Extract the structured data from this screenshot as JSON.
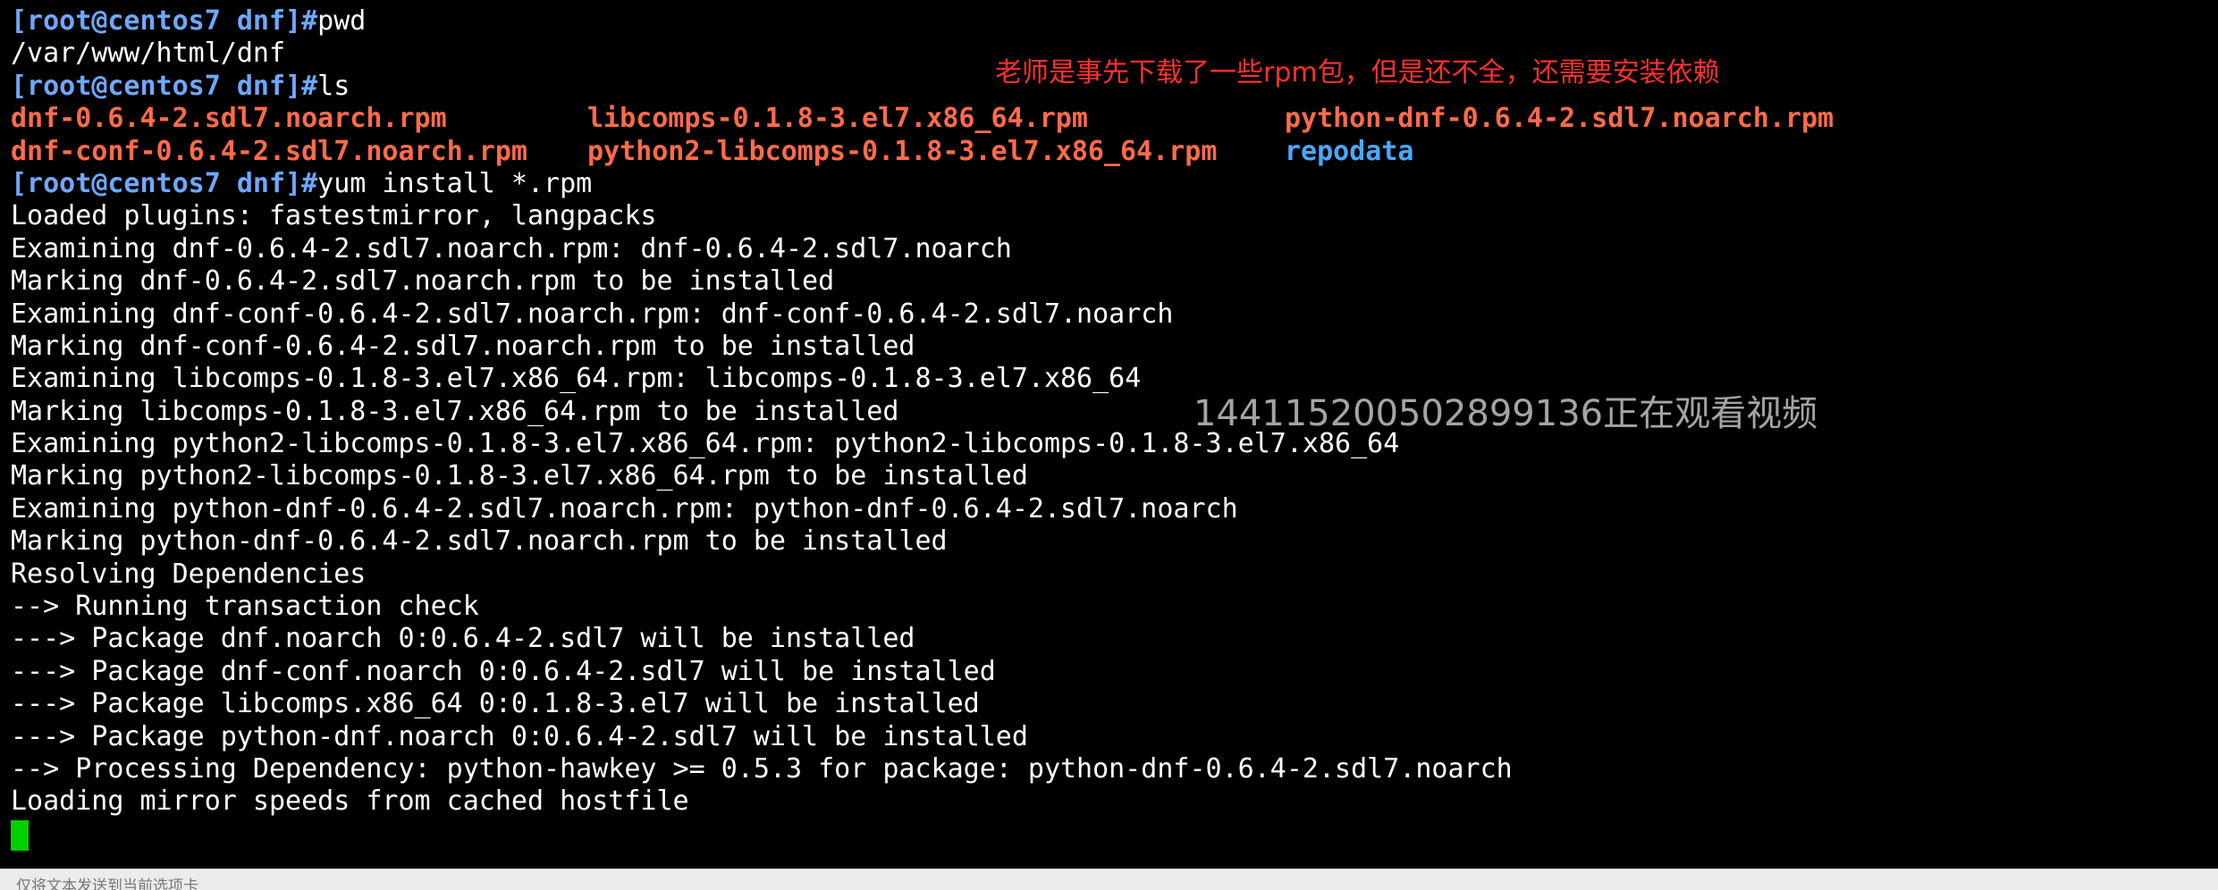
{
  "terminal": {
    "lines": [
      {
        "type": "prompt",
        "prompt": "[root@centos7 dnf]#",
        "cmd": "pwd"
      },
      {
        "type": "out",
        "text": "/var/www/html/dnf"
      },
      {
        "type": "prompt",
        "prompt": "[root@centos7 dnf]#",
        "cmd": "ls"
      },
      {
        "type": "ls",
        "items": [
          {
            "text": "dnf-0.6.4-2.sdl7.noarch.rpm",
            "kind": "rpm"
          },
          {
            "text": "libcomps-0.1.8-3.el7.x86_64.rpm",
            "kind": "rpm"
          },
          {
            "text": "python-dnf-0.6.4-2.sdl7.noarch.rpm",
            "kind": "rpm"
          }
        ]
      },
      {
        "type": "ls",
        "items": [
          {
            "text": "dnf-conf-0.6.4-2.sdl7.noarch.rpm",
            "kind": "rpm"
          },
          {
            "text": "python2-libcomps-0.1.8-3.el7.x86_64.rpm",
            "kind": "rpm"
          },
          {
            "text": "repodata",
            "kind": "dir"
          }
        ]
      },
      {
        "type": "prompt",
        "prompt": "[root@centos7 dnf]#",
        "cmd": "yum install *.rpm"
      },
      {
        "type": "out",
        "text": "Loaded plugins: fastestmirror, langpacks"
      },
      {
        "type": "out",
        "text": "Examining dnf-0.6.4-2.sdl7.noarch.rpm: dnf-0.6.4-2.sdl7.noarch"
      },
      {
        "type": "out",
        "text": "Marking dnf-0.6.4-2.sdl7.noarch.rpm to be installed"
      },
      {
        "type": "out",
        "text": "Examining dnf-conf-0.6.4-2.sdl7.noarch.rpm: dnf-conf-0.6.4-2.sdl7.noarch"
      },
      {
        "type": "out",
        "text": "Marking dnf-conf-0.6.4-2.sdl7.noarch.rpm to be installed"
      },
      {
        "type": "out",
        "text": "Examining libcomps-0.1.8-3.el7.x86_64.rpm: libcomps-0.1.8-3.el7.x86_64"
      },
      {
        "type": "out",
        "text": "Marking libcomps-0.1.8-3.el7.x86_64.rpm to be installed"
      },
      {
        "type": "out",
        "text": "Examining python2-libcomps-0.1.8-3.el7.x86_64.rpm: python2-libcomps-0.1.8-3.el7.x86_64"
      },
      {
        "type": "out",
        "text": "Marking python2-libcomps-0.1.8-3.el7.x86_64.rpm to be installed"
      },
      {
        "type": "out",
        "text": "Examining python-dnf-0.6.4-2.sdl7.noarch.rpm: python-dnf-0.6.4-2.sdl7.noarch"
      },
      {
        "type": "out",
        "text": "Marking python-dnf-0.6.4-2.sdl7.noarch.rpm to be installed"
      },
      {
        "type": "out",
        "text": "Resolving Dependencies"
      },
      {
        "type": "out",
        "text": "--> Running transaction check"
      },
      {
        "type": "out",
        "text": "---> Package dnf.noarch 0:0.6.4-2.sdl7 will be installed"
      },
      {
        "type": "out",
        "text": "---> Package dnf-conf.noarch 0:0.6.4-2.sdl7 will be installed"
      },
      {
        "type": "out",
        "text": "---> Package libcomps.x86_64 0:0.1.8-3.el7 will be installed"
      },
      {
        "type": "out",
        "text": "---> Package python-dnf.noarch 0:0.6.4-2.sdl7 will be installed"
      },
      {
        "type": "out",
        "text": "--> Processing Dependency: python-hawkey >= 0.5.3 for package: python-dnf-0.6.4-2.sdl7.noarch"
      },
      {
        "type": "out",
        "text": "Loading mirror speeds from cached hostfile"
      }
    ]
  },
  "annotation": "老师是事先下载了一些rpm包，但是还不全，还需要安装依赖",
  "watermark": "1441152005028991​36正在观看视频",
  "statusbar": {
    "text": "仅将文本发送到当前选项卡"
  },
  "colors": {
    "background": "#000000",
    "text": "#ffffff",
    "prompt": "#6fa8ff",
    "rpm_file": "#ff6b4a",
    "directory": "#4aa8ff",
    "cursor": "#00d000",
    "annotation": "#ff3030"
  }
}
